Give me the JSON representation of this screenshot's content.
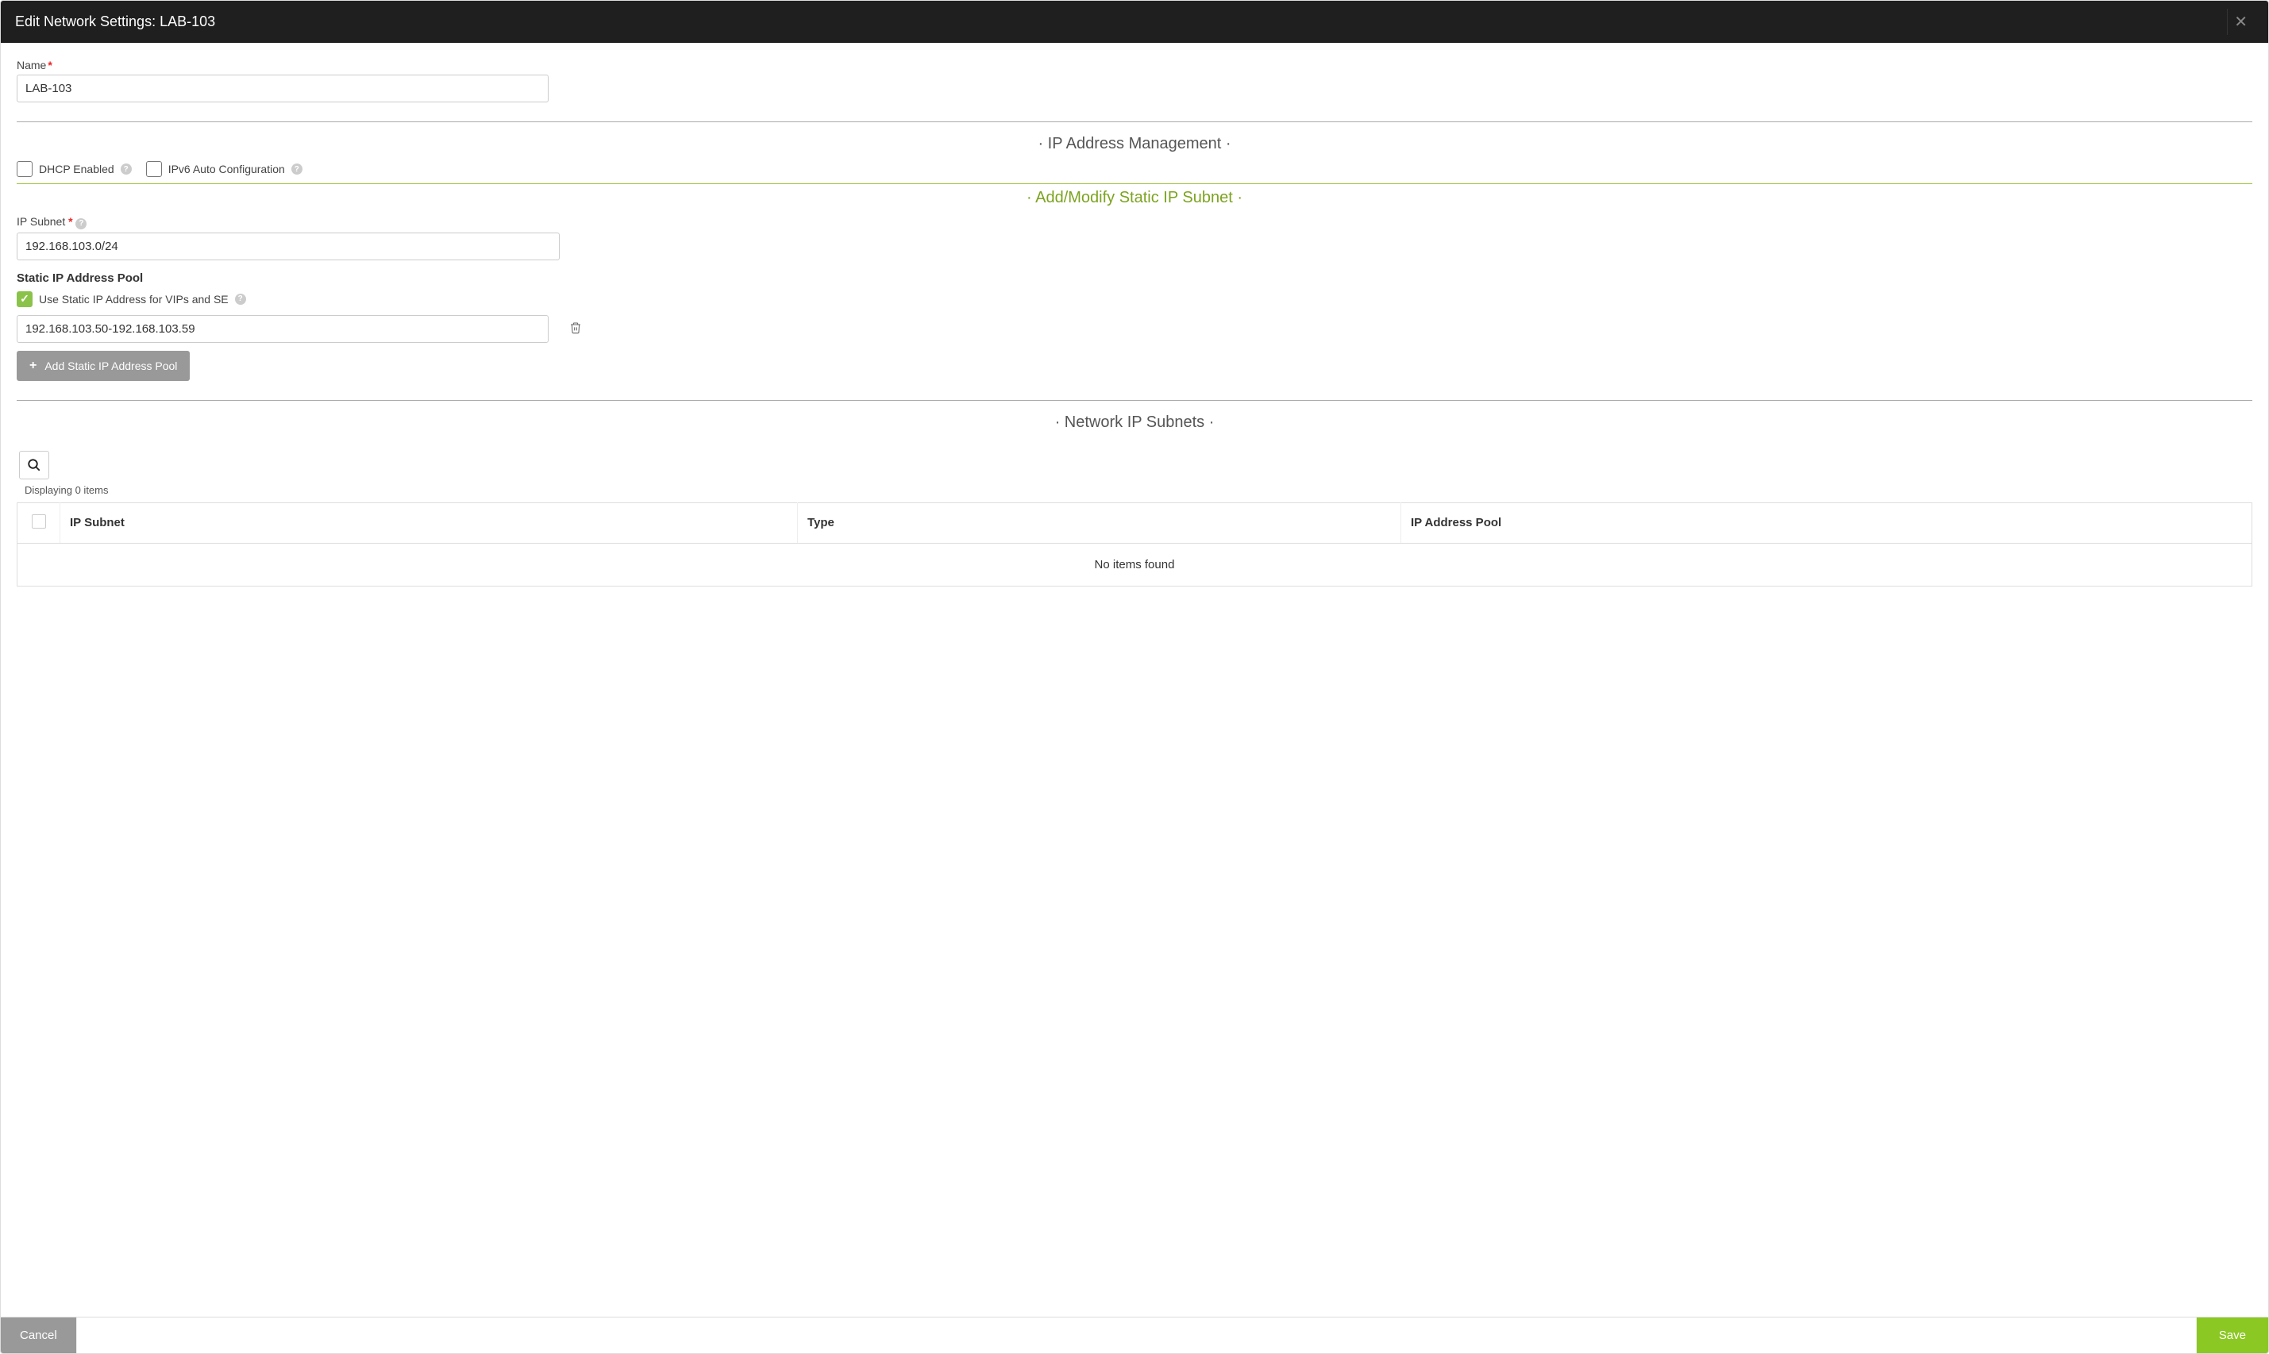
{
  "modal": {
    "title": "Edit Network Settings: LAB-103"
  },
  "form": {
    "name_label": "Name",
    "name_value": "LAB-103",
    "sections": {
      "ipam_header": "IP Address Management",
      "subnet_header": "Add/Modify Static IP Subnet",
      "network_subnets_header": "Network IP Subnets"
    },
    "dhcp_label": "DHCP Enabled",
    "dhcp_checked": false,
    "ipv6_label": "IPv6 Auto Configuration",
    "ipv6_checked": false,
    "ip_subnet_label": "IP Subnet",
    "ip_subnet_value": "192.168.103.0/24",
    "static_pool_heading": "Static IP Address Pool",
    "use_static_label": "Use Static IP Address for VIPs and SE",
    "use_static_checked": true,
    "pool_range_value": "192.168.103.50-192.168.103.59",
    "add_pool_label": "Add Static IP Address Pool"
  },
  "table": {
    "displaying": "Displaying 0 items",
    "headers": {
      "ip_subnet": "IP Subnet",
      "type": "Type",
      "ip_pool": "IP Address Pool"
    },
    "empty_text": "No items found"
  },
  "footer": {
    "cancel": "Cancel",
    "save": "Save"
  }
}
